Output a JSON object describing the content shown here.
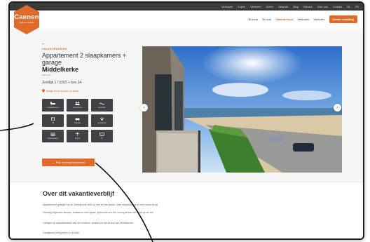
{
  "topbar": {
    "links": [
      "Verkopen",
      "Kopen",
      "Verhuren",
      "Huren",
      "Vakantie",
      "Blog",
      "Nieuws",
      "Over ons",
      "Contact",
      "NL",
      "FR"
    ]
  },
  "logo": {
    "brand": "Caenen",
    "tagline": "vastgoed & vakantie"
  },
  "header": {
    "nav": [
      "Te koop",
      "Te huur",
      "Vakantiehuur",
      "Verkopen",
      "Verhuren"
    ],
    "active_index": 2,
    "cta": "Gratis schatting"
  },
  "breadcrumb": "«",
  "property": {
    "kicker": "VAKANTIEWONING",
    "title": "Appartement 2 slaapkamers + garage",
    "city": "Middelkerke",
    "region": "aan zee",
    "address": "Zeedijk 1 / 0202 + box 24",
    "maplink": "Bekijk deze locatie op kaart"
  },
  "features": [
    {
      "label": "2 slaapkamers",
      "icon": "bed-icon"
    },
    {
      "label": "4 personen",
      "icon": "people-icon"
    },
    {
      "label": "Zeezicht",
      "icon": "wave-icon"
    },
    {
      "label": "Lift",
      "icon": "lift-icon"
    },
    {
      "label": "Garage",
      "icon": "car-icon"
    },
    {
      "label": "Huisdieren",
      "icon": "paw-icon"
    },
    {
      "label": "Wasmachine",
      "icon": "washer-icon"
    },
    {
      "label": "Terras",
      "icon": "terrace-icon"
    },
    {
      "label": "TV",
      "icon": "tv-icon"
    }
  ],
  "book_button": "Prijs en beschikbaarheid",
  "about": {
    "heading": "Over dit vakantieverblijf",
    "paragraphs": [
      "Appartement gelegen op de Zeedijk met zicht op zee en het strand, twee slaapkamers en een ruime living.",
      "Volledig uitgeruste keuken, badkamer met ligbad, apart toilet en een zonnig terras met zicht op de zee.",
      "Gelegen op wandelafstand van het centrum, winkels en het strand van Middelkerke.",
      "Garagebox inbegrepen in de prijs."
    ]
  },
  "colors": {
    "accent": "#e06a2a",
    "dark": "#3e4245"
  }
}
